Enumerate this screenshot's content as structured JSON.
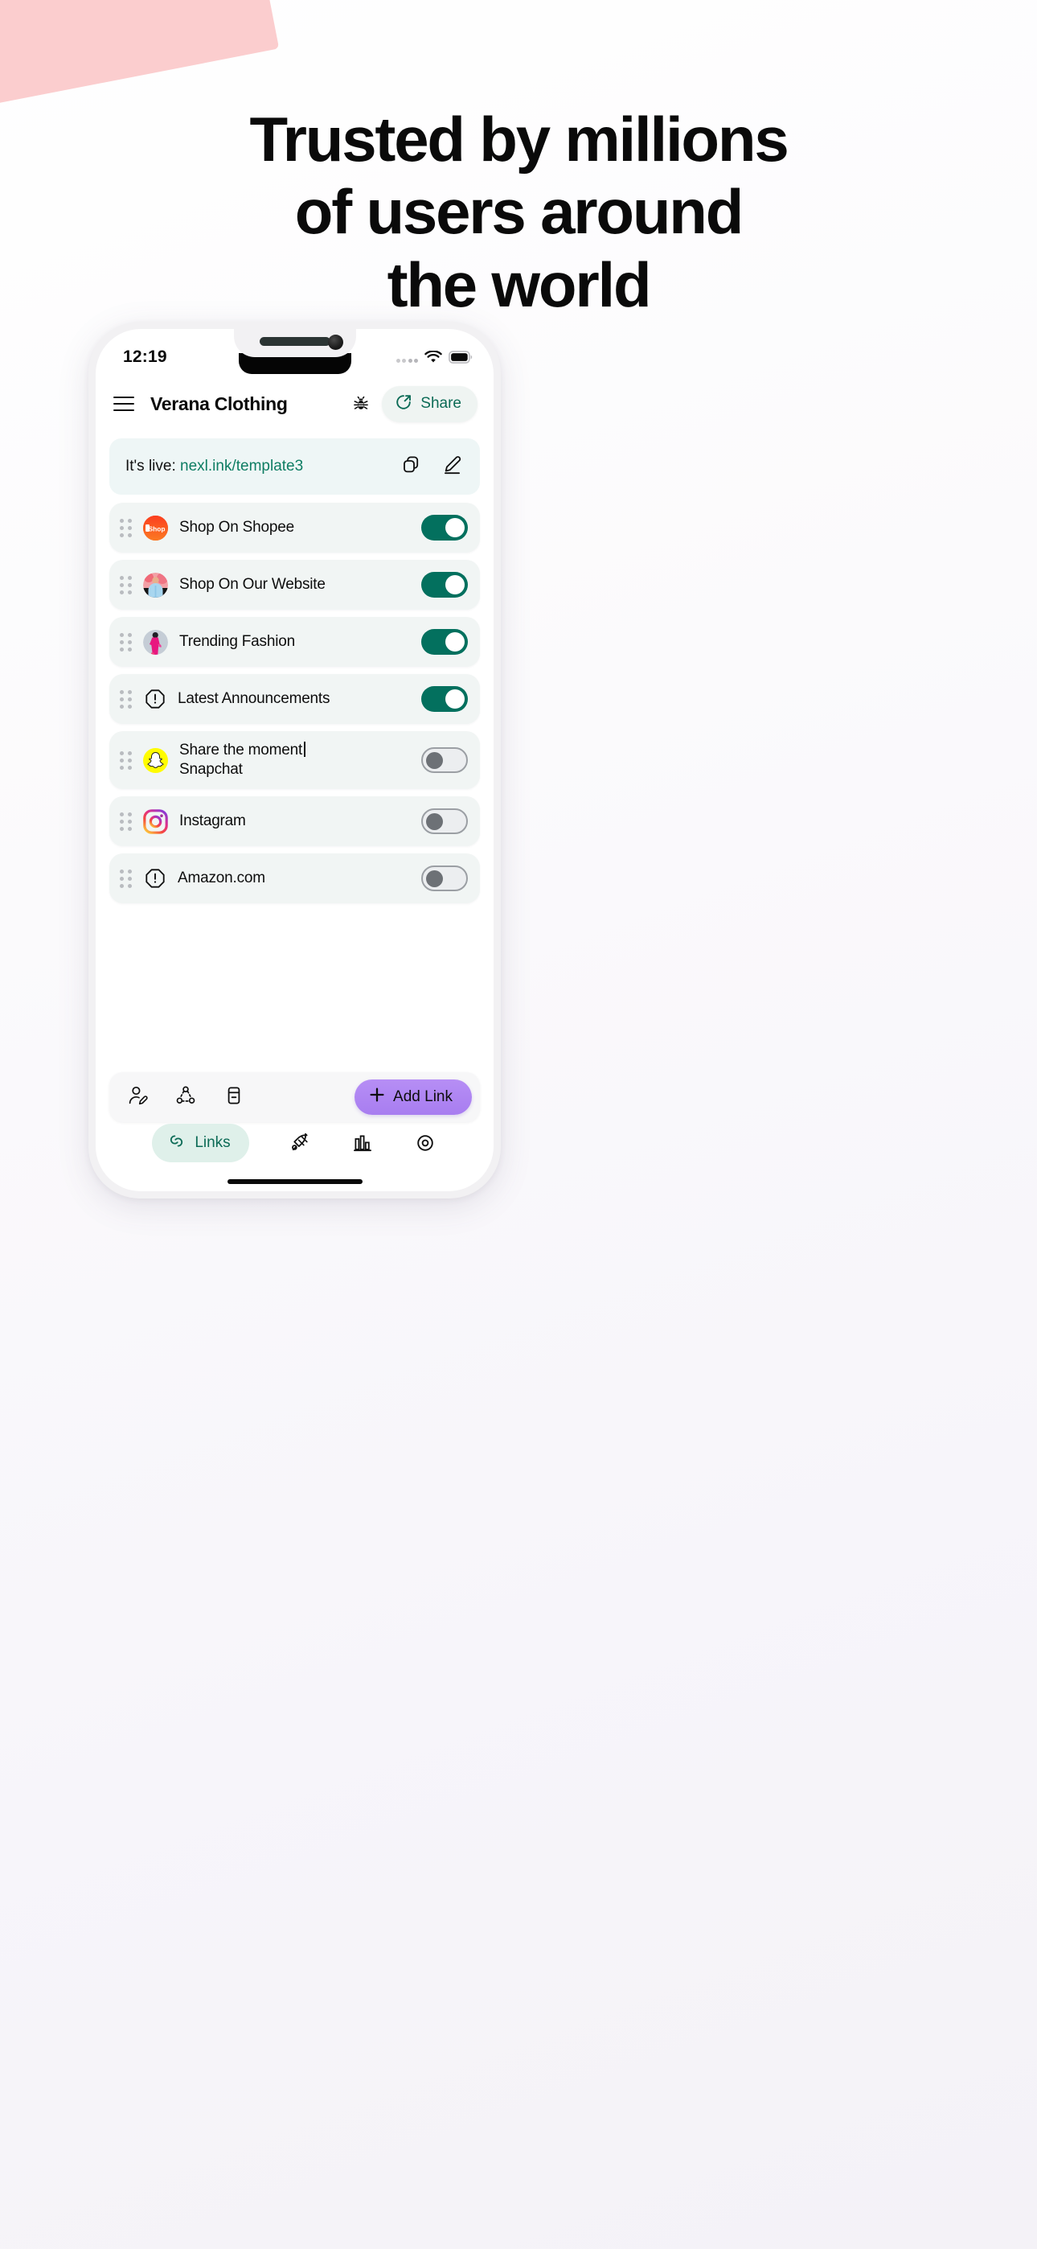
{
  "hero": {
    "headline_lines": [
      "Trusted by millions",
      "of users around",
      "the world"
    ]
  },
  "colors": {
    "accent_teal": "#0c6b56",
    "toggle_on": "#03705e",
    "toggle_off_track": "#eceef0",
    "add_link_purple": "#a87df0",
    "link_row_bg": "#f1f5f4",
    "live_banner_bg": "#eef6f6",
    "corner_wedge_pink": "#fbcdce"
  },
  "phone": {
    "statusbar": {
      "time": "12:19",
      "signal_icon": "signal-dots-icon",
      "wifi_icon": "wifi-icon",
      "battery_icon": "battery-full-icon"
    },
    "header": {
      "menu_icon": "hamburger-menu-icon",
      "title": "Verana Clothing",
      "bug_icon": "bug-icon",
      "share_label": "Share",
      "share_icon": "share-circle-arrow-icon"
    },
    "live_banner": {
      "prefix": "It's live: ",
      "url": "nexl.ink/template3",
      "copy_icon": "copy-icon",
      "edit_icon": "pencil-edit-icon"
    },
    "links": [
      {
        "label": "Shop On Shopee",
        "icon": "shopee-icon",
        "enabled": true,
        "icon_type": "shopee"
      },
      {
        "label": "Shop On Our Website",
        "icon": "website-photo-icon",
        "enabled": true,
        "icon_type": "photo-blue"
      },
      {
        "label": "Trending Fashion",
        "icon": "fashion-photo-icon",
        "enabled": true,
        "icon_type": "photo-pink"
      },
      {
        "label": "Latest Announcements",
        "icon": "alert-octagon-icon",
        "enabled": true,
        "icon_type": "octagon"
      },
      {
        "label": "Share the moment |\nSnapchat",
        "label_line1": "Share the moment",
        "label_line2": "Snapchat",
        "icon": "snapchat-icon",
        "enabled": false,
        "icon_type": "snapchat"
      },
      {
        "label": "Instagram",
        "icon": "instagram-icon",
        "enabled": false,
        "icon_type": "instagram"
      },
      {
        "label": "Amazon.com",
        "icon": "alert-octagon-icon",
        "enabled": false,
        "icon_type": "octagon"
      }
    ],
    "action_bar": {
      "profile_edit_icon": "user-edit-icon",
      "share_nodes_icon": "share-nodes-icon",
      "archive_icon": "archive-icon",
      "add_link_label": "Add Link",
      "add_link_plus_icon": "plus-icon"
    },
    "bottom_nav": {
      "links_label": "Links",
      "links_icon": "chain-link-icon",
      "design_icon": "rocket-design-icon",
      "analytics_icon": "bar-chart-icon",
      "preview_icon": "eye-preview-icon"
    }
  }
}
